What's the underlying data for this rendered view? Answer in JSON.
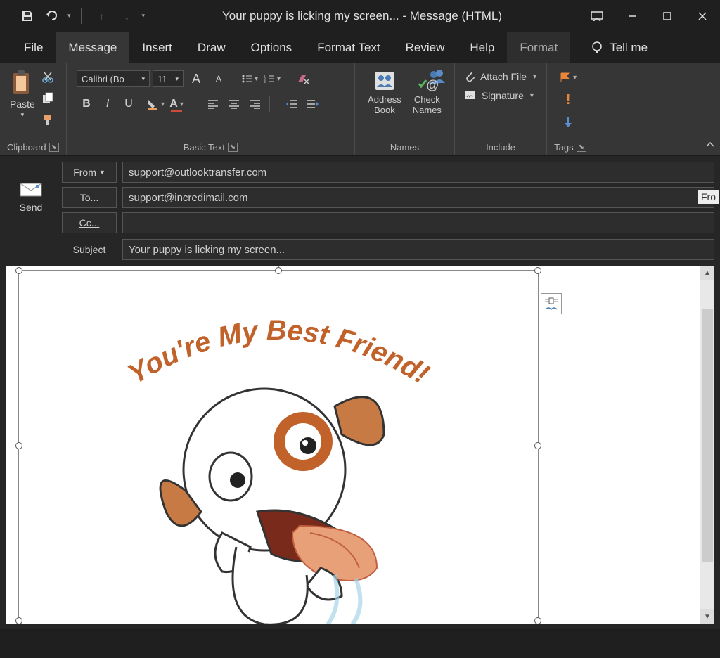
{
  "title": "Your puppy is licking my screen...  -  Message (HTML)",
  "tabs": {
    "file": "File",
    "message": "Message",
    "insert": "Insert",
    "draw": "Draw",
    "options": "Options",
    "format_text": "Format Text",
    "review": "Review",
    "help": "Help",
    "format": "Format",
    "tell_me": "Tell me"
  },
  "ribbon": {
    "clipboard": {
      "paste": "Paste",
      "label": "Clipboard"
    },
    "basic_text": {
      "font": "Calibri (Bo",
      "size": "11",
      "label": "Basic Text"
    },
    "names": {
      "address_book": "Address\nBook",
      "check_names": "Check\nNames",
      "label": "Names"
    },
    "include": {
      "attach_file": "Attach File",
      "signature": "Signature",
      "label": "Include"
    },
    "tags": {
      "label": "Tags"
    }
  },
  "compose": {
    "send": "Send",
    "from_label": "From",
    "from_value": "support@outlooktransfer.com",
    "to_label": "To...",
    "to_value": "support@incredimail.com",
    "cc_label": "Cc...",
    "cc_value": "",
    "subject_label": "Subject",
    "subject_value": "Your puppy is licking my screen...",
    "from_hint": "Fro"
  },
  "body": {
    "arc_text": "You're My Best Friend!"
  }
}
